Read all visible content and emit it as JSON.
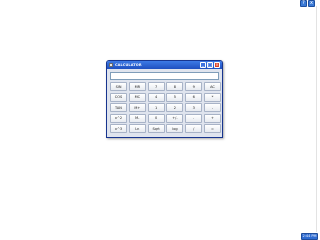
{
  "window": {
    "title": "CALCULATOR",
    "minimize_icon": "minimize-icon",
    "maximize_icon": "maximize-icon",
    "close_icon": "close-icon"
  },
  "display": {
    "value": ""
  },
  "keys": [
    [
      "SIN",
      "MR",
      "7",
      "8",
      "9",
      "AC"
    ],
    [
      "COS",
      "MC",
      "4",
      "5",
      "6",
      "*"
    ],
    [
      "TAN",
      "M+",
      "1",
      "2",
      "3",
      "-"
    ],
    [
      "x^2",
      "M-",
      "0",
      "+/-",
      ".",
      "+"
    ],
    [
      "x^3",
      "Ln",
      "Sqrt",
      "log",
      "/",
      "="
    ]
  ],
  "taskbar": {
    "clock": "2:44 PM",
    "tray_buttons": [
      "?",
      "x"
    ]
  },
  "colors": {
    "titlebar": "#1e4fc0",
    "close": "#d9432b"
  }
}
